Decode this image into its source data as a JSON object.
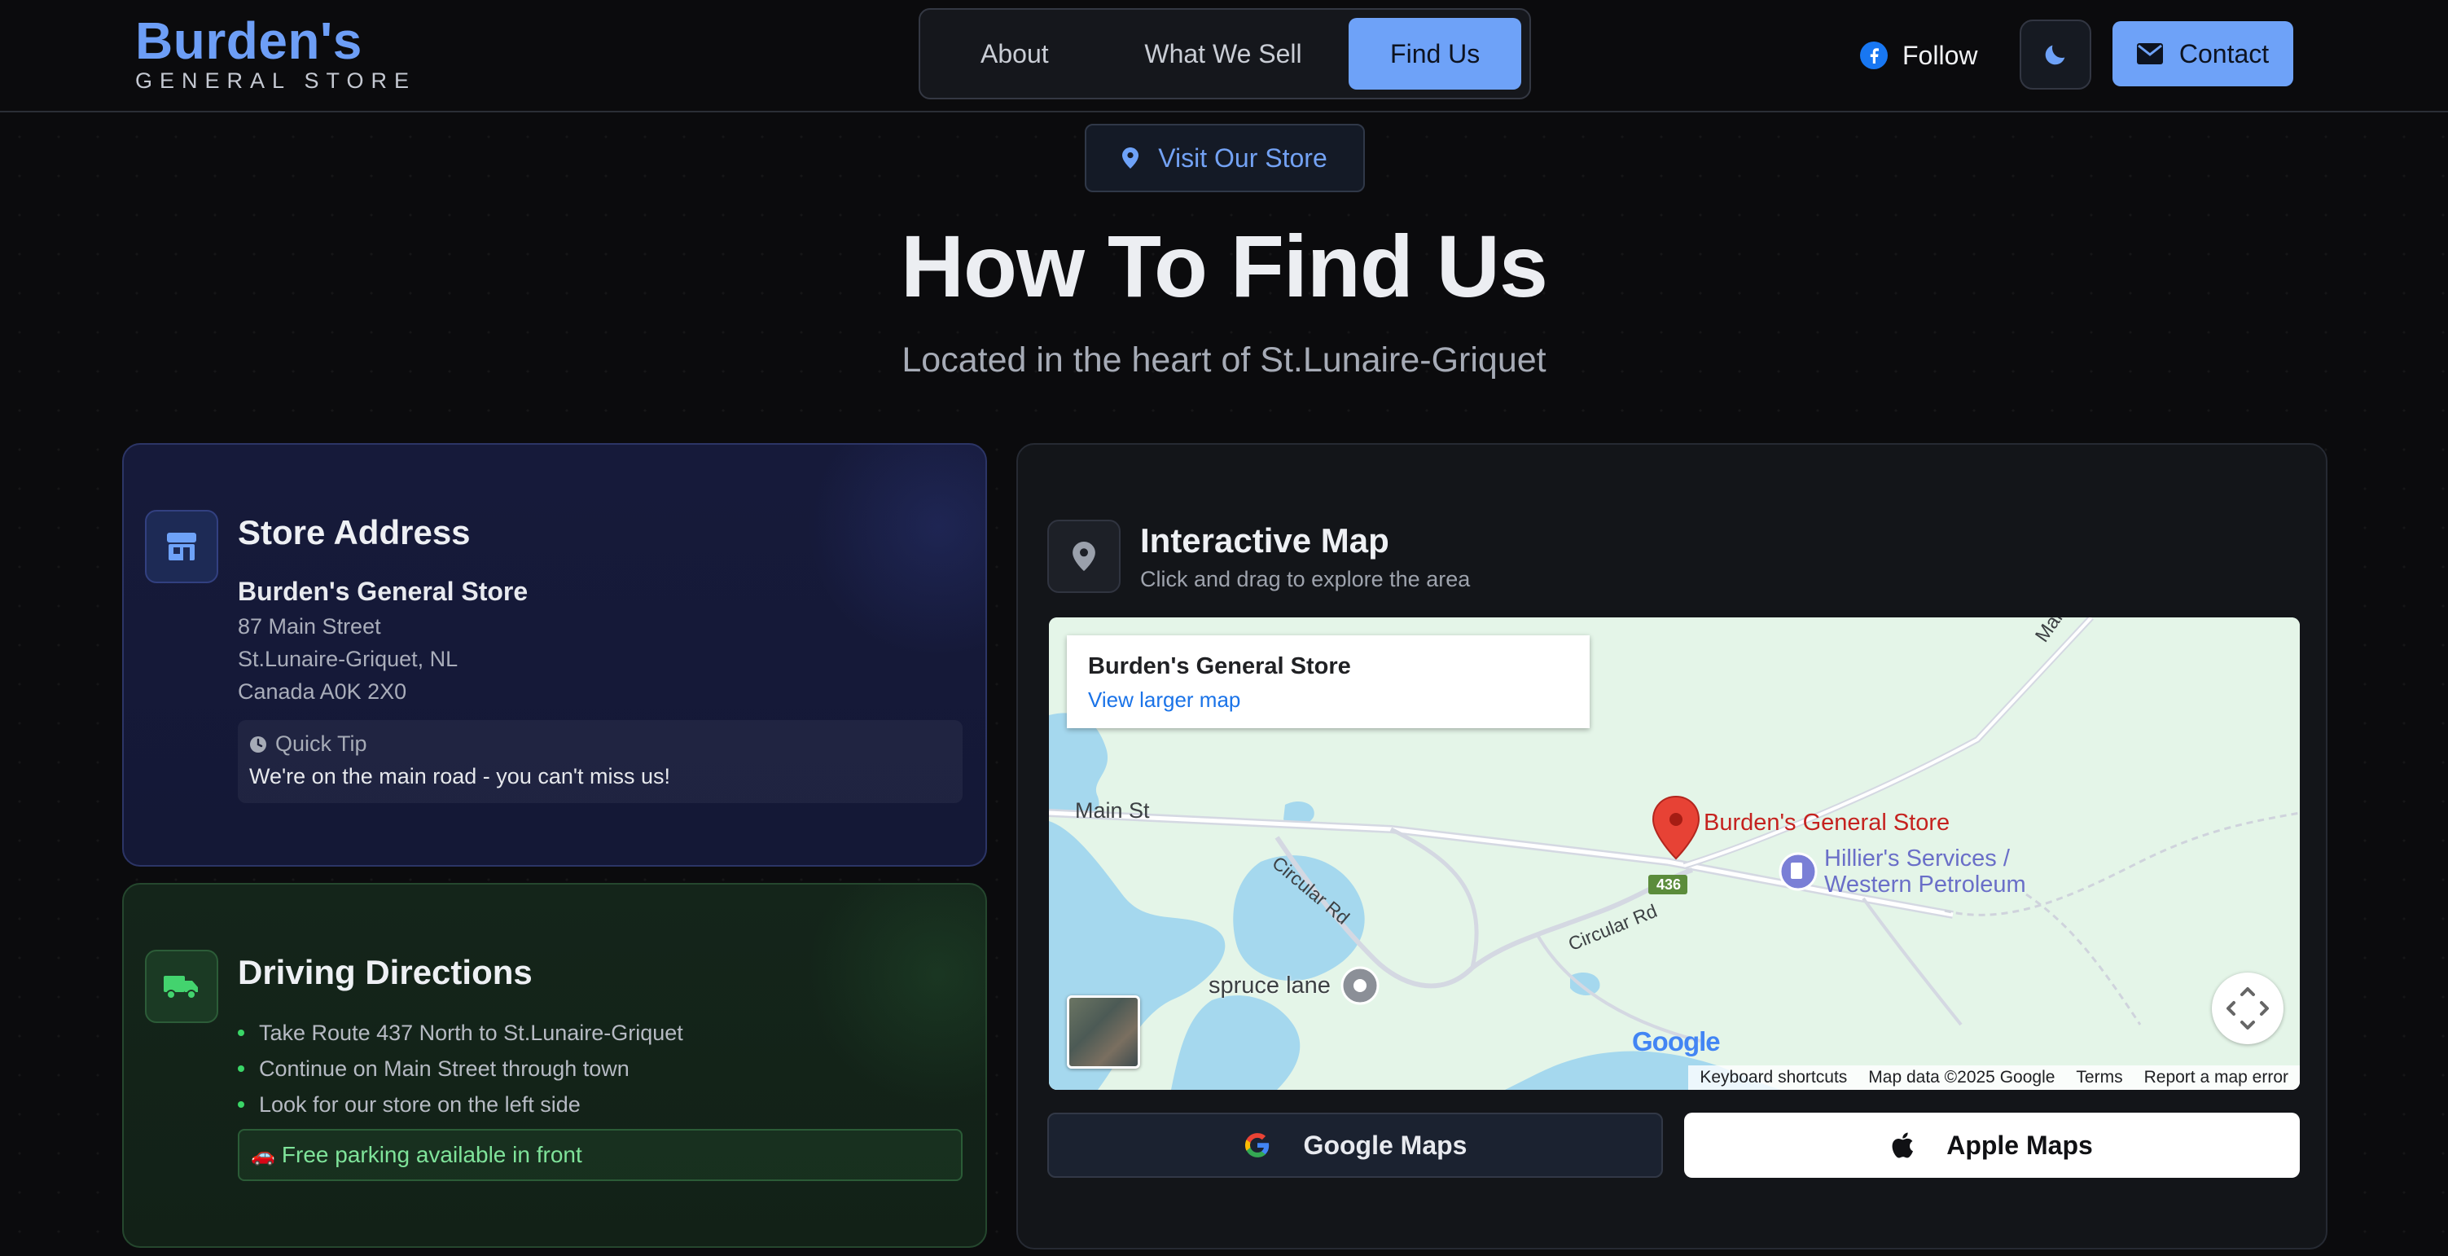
{
  "brand": {
    "title": "Burden's",
    "subtitle": "GENERAL STORE",
    "accent_color": "#6ea2f8"
  },
  "nav": {
    "items": [
      {
        "label": "About"
      },
      {
        "label": "What We Sell"
      },
      {
        "label": "Find Us",
        "active": true
      }
    ]
  },
  "header_actions": {
    "follow_label": "Follow",
    "follow_icon": "facebook-icon",
    "theme_icon": "moon-icon",
    "contact_label": "Contact",
    "contact_icon": "mail-icon"
  },
  "hero": {
    "badge": "Visit Our Store",
    "badge_icon": "map-pin-icon",
    "title": "How To Find Us",
    "subtitle": "Located in the heart of St.Lunaire-Griquet"
  },
  "address_card": {
    "title": "Store Address",
    "icon": "store-icon",
    "store_name": "Burden's General Store",
    "lines": [
      "87 Main Street",
      "St.Lunaire-Griquet, NL",
      "Canada A0K 2X0"
    ],
    "tip_label": "Quick Tip",
    "tip_text": "We're on the main road - you can't miss us!"
  },
  "directions_card": {
    "title": "Driving Directions",
    "icon": "truck-icon",
    "steps": [
      "Take Route 437 North to St.Lunaire-Griquet",
      "Continue on Main Street through town",
      "Look for our store on the left side"
    ],
    "parking_note": "Free parking available in front",
    "parking_icon": "🚗"
  },
  "map_card": {
    "title": "Interactive Map",
    "subtitle": "Click and drag to explore the area",
    "icon": "map-pin-icon",
    "map": {
      "info_name": "Burden's General Store",
      "info_link": "View larger map",
      "pin_label": "Burden's General Store",
      "poi_label_1": "Hillier's Services /",
      "poi_label_2": "Western Petroleum",
      "road_main": "Main St",
      "road_main_ne": "Main",
      "road_circular_1": "Circular Rd",
      "road_circular_2": "Circular Rd",
      "route_shield": "436",
      "place_spruce": "spruce lane",
      "google_logo": "Google",
      "attribution": [
        "Keyboard shortcuts",
        "Map data ©2025 Google",
        "Terms",
        "Report a map error"
      ]
    },
    "google_button": "Google Maps",
    "apple_button": "Apple Maps"
  }
}
